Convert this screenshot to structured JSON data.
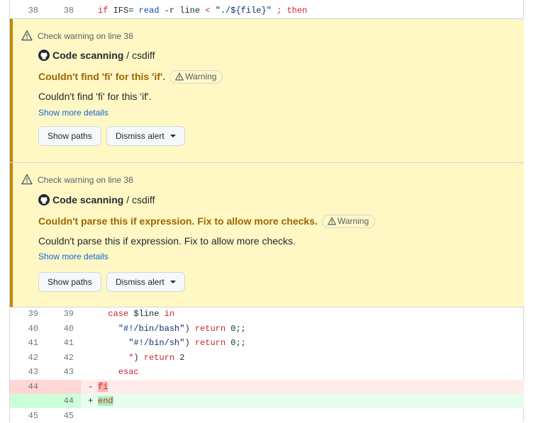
{
  "diff_top": {
    "old": "38",
    "new": "38",
    "tokens": {
      "kw1": "if",
      "v1": " IFS=",
      "bi1": " read",
      "t1": " -r line ",
      "kw2": "<",
      "t2": " ",
      "str1": "\"./${file}\"",
      "t3": " ",
      "kw3": "; then"
    }
  },
  "alerts": [
    {
      "header": "Check warning on line 38",
      "tool": "Code scanning",
      "repo": "/ csdiff",
      "title": "Couldn't find 'fi' for this 'if'.",
      "badge": "Warning",
      "description": "Couldn't find 'fi' for this 'if'.",
      "more": "Show more details",
      "show_paths": "Show paths",
      "dismiss": "Dismiss alert"
    },
    {
      "header": "Check warning on line 38",
      "tool": "Code scanning",
      "repo": "/ csdiff",
      "title": "Couldn't parse this if expression. Fix to allow more checks.",
      "badge": "Warning",
      "description": "Couldn't parse this if expression. Fix to allow more checks.",
      "more": "Show more details",
      "show_paths": "Show paths",
      "dismiss": "Dismiss alert"
    }
  ],
  "diff_bottom": [
    {
      "old": "39",
      "new": "39",
      "sign": "",
      "code": {
        "indent": "  ",
        "kw": "case",
        "rest": " $line ",
        "kw2": "in"
      }
    },
    {
      "old": "40",
      "new": "40",
      "sign": "",
      "code": {
        "indent": "    ",
        "str": "\"#!/bin/bash\"",
        "rest": ") ",
        "kw": "return",
        "rest2": " 0;;"
      }
    },
    {
      "old": "41",
      "new": "41",
      "sign": "",
      "code": {
        "indent": "      ",
        "str": "\"#!/bin/sh\"",
        "rest": ") ",
        "kw": "return",
        "rest2": " 0;;"
      }
    },
    {
      "old": "42",
      "new": "42",
      "sign": "",
      "code": {
        "indent": "      ",
        "kw0": "*",
        "rest": ") ",
        "kw": "return",
        "rest2": " 2"
      }
    },
    {
      "old": "43",
      "new": "43",
      "sign": "",
      "code": {
        "indent": "    ",
        "kw": "esac"
      }
    },
    {
      "old": "44",
      "new": "",
      "sign": "-",
      "code": {
        "text": "fi"
      }
    },
    {
      "old": "",
      "new": "44",
      "sign": "+",
      "code": {
        "text": "end"
      }
    },
    {
      "old": "45",
      "new": "45",
      "sign": "",
      "code": {
        "text": ""
      }
    }
  ],
  "colors": {
    "warning_accent": "#bf8700",
    "warning_bg": "#fff8c5",
    "deleted_bg": "#ffebe9",
    "added_bg": "#e6ffec",
    "link": "#0969da"
  }
}
